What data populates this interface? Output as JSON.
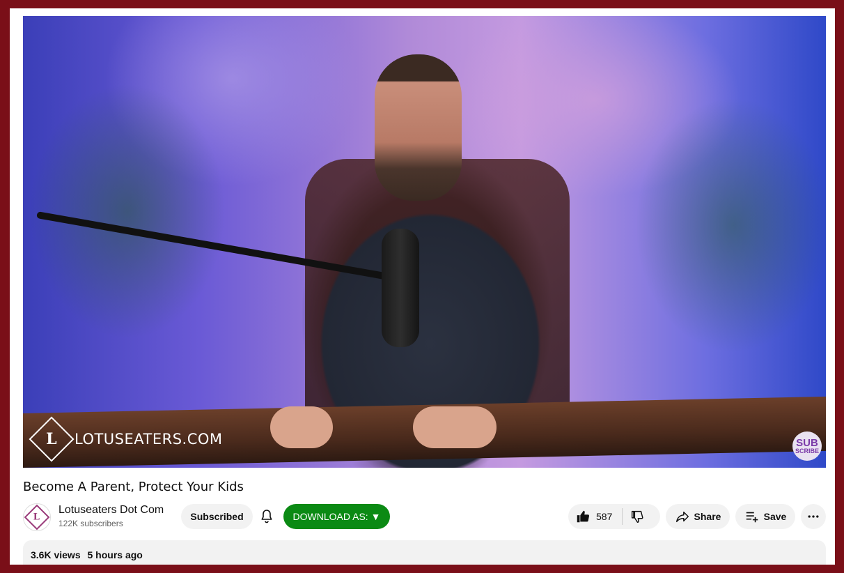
{
  "video": {
    "watermark_text": "LOTUSEATERS.COM",
    "logo_letter": "L",
    "subscribe_badge_top": "SUB",
    "subscribe_badge_bottom": "SCRIBE"
  },
  "title": "Become A Parent, Protect Your Kids",
  "channel": {
    "name": "Lotuseaters Dot Com",
    "subscribers": "122K subscribers",
    "avatar_letter": "L"
  },
  "actions": {
    "subscribed_label": "Subscribed",
    "download_label": "DOWNLOAD AS: ▼",
    "like_count": "587",
    "share_label": "Share",
    "save_label": "Save"
  },
  "description": {
    "views": "3.6K views",
    "posted": "5 hours ago"
  },
  "colors": {
    "page_border": "#7a0f18",
    "download_button": "#0b8a14",
    "pill_background": "#f2f2f2"
  },
  "icons": [
    "bell-icon",
    "thumbs-up-icon",
    "thumbs-down-icon",
    "share-icon",
    "save-playlist-icon",
    "more-icon"
  ]
}
